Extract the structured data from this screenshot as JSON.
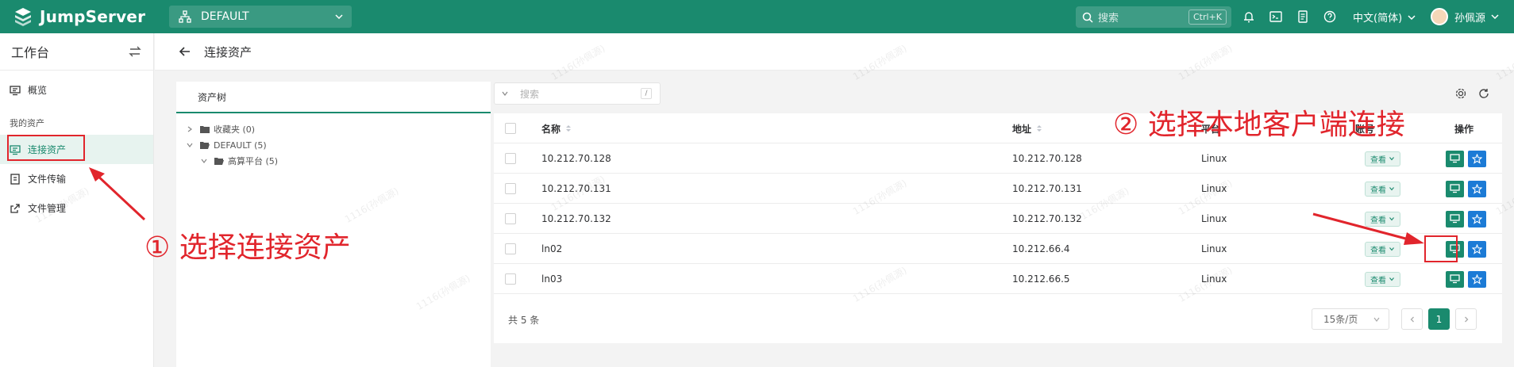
{
  "colors": {
    "brand": "#1a8a6e",
    "annotation": "#e1252c",
    "star": "#1c7bd6"
  },
  "topbar": {
    "app_name": "JumpServer",
    "org": "DEFAULT",
    "search_placeholder": "搜索",
    "search_shortcut": "Ctrl+K",
    "language": "中文(简体)",
    "user_name": "孙佩源"
  },
  "sidebar": {
    "title": "工作台",
    "items": [
      {
        "label": "概览",
        "icon": "monitor-icon"
      },
      {
        "label": "连接资产",
        "icon": "connect-icon"
      },
      {
        "label": "文件传输",
        "icon": "file-transfer-icon"
      },
      {
        "label": "文件管理",
        "icon": "external-link-icon"
      }
    ],
    "group_label": "我的资产"
  },
  "breadcrumb": {
    "title": "连接资产"
  },
  "tree": {
    "tab_label": "资产树",
    "nodes": [
      {
        "label": "收藏夹 (0)"
      },
      {
        "label": "DEFAULT (5)"
      },
      {
        "label": "高算平台 (5)"
      }
    ]
  },
  "table": {
    "search_placeholder": "搜索",
    "search_shortcut": "/",
    "columns": {
      "name": "名称",
      "address": "地址",
      "platform": "平台",
      "account": "账号",
      "actions": "操作"
    },
    "rows": [
      {
        "name": "10.212.70.128",
        "address": "10.212.70.128",
        "platform": "Linux",
        "account_label": "查看"
      },
      {
        "name": "10.212.70.131",
        "address": "10.212.70.131",
        "platform": "Linux",
        "account_label": "查看"
      },
      {
        "name": "10.212.70.132",
        "address": "10.212.70.132",
        "platform": "Linux",
        "account_label": "查看"
      },
      {
        "name": "ln02",
        "address": "10.212.66.4",
        "platform": "Linux",
        "account_label": "查看"
      },
      {
        "name": "ln03",
        "address": "10.212.66.5",
        "platform": "Linux",
        "account_label": "查看"
      }
    ],
    "total_label": "共 5 条",
    "page_size": "15条/页",
    "current_page": "1"
  },
  "annotations": {
    "step1": "① 选择连接资产",
    "step2": "② 选择本地客户端连接"
  },
  "watermark_text": "1116(孙佩源)"
}
